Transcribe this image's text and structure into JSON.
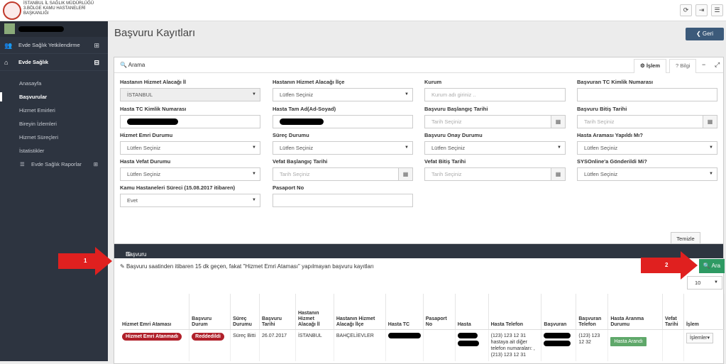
{
  "header": {
    "org_line1": "İSTANBUL İL SAĞLIK MÜDÜRLÜĞÜ",
    "org_line2": "3.BÖLGE KAMU HASTANELERİ",
    "org_line3": "BAŞKANLIĞI",
    "buttons": [
      "refresh-icon",
      "logout-icon",
      "menu-icon"
    ]
  },
  "sidebar": {
    "sections": [
      {
        "label": "Evde Sağlık Yetkilendirme",
        "toggle": "⊞"
      },
      {
        "label": "Evde Sağlık",
        "toggle": "⊟"
      }
    ],
    "items": [
      "Anasayfa",
      "Başvurular",
      "Hizmet Emirleri",
      "Bireyin İzlemleri",
      "Hizmet Süreçleri",
      "İstatistikler",
      "Evde Sağlık Raporlar"
    ],
    "reports_toggle": "⊞"
  },
  "page": {
    "title": "Başvuru Kayıtları",
    "back_label": "Geri"
  },
  "search": {
    "title": "Arama",
    "tab_islem": "İşlem",
    "tab_bilgi": "Bilgi",
    "minimize": "−",
    "expand": "⤢",
    "labels": {
      "il": "Hastanın Hizmet Alacağı İl",
      "ilce": "Hastanın Hizmet Alacağı İlçe",
      "kurum": "Kurum",
      "basvuran_tc": "Başvuran TC Kimlik Numarası",
      "hasta_tc": "Hasta TC Kimlik Numarası",
      "hasta_ad": "Hasta Tam Ad(Ad-Soyad)",
      "bas_baslangic": "Başvuru Başlangıç Tarihi",
      "bas_bitis": "Başvuru Bitiş Tarihi",
      "hizmet_emri": "Hizmet Emri Durumu",
      "surec": "Süreç Durumu",
      "onay": "Başvuru Onay Durumu",
      "aranma": "Hasta Araması Yapıldı Mı?",
      "vefat": "Hasta Vefat Durumu",
      "vefat_bas": "Vefat Başlangıç Tarihi",
      "vefat_bit": "Vefat Bitiş Tarihi",
      "sysonline": "SYSOnline'a Gönderildi Mi?",
      "kamu": "Kamu Hastaneleri Süreci",
      "kamu_date": "(15.08.2017 itibaren)",
      "pasaport": "Pasaport No"
    },
    "values": {
      "il": "İSTANBUL",
      "select_default": "Lütfen Seçiniz",
      "kurum_placeholder": "Kurum adı giriniz ..",
      "date_placeholder": "Tarih Seçiniz",
      "kamu": "Evet"
    },
    "clear_label": "Temizle"
  },
  "records": {
    "title": "Başvuru Kayıtları",
    "notice": "Başvuru saatinden itibaren 15 dk geçen, fakat \"Hizmet Emri Ataması\" yapılmayan başvuru kayıtları",
    "search_label": "Ara",
    "page_size": "10",
    "columns": [
      "Hizmet Emri Ataması",
      "Başvuru Durum",
      "Süreç Durumu",
      "Başvuru Tarihi",
      "Hastanın Hizmet Alacağı İl",
      "Hastanın Hizmet Alacağı İlçe",
      "Hasta TC",
      "Pasaport No",
      "Hasta",
      "Hasta Telefon",
      "Başvuran",
      "Başvuran Telefon",
      "Hasta Aranma Durumu",
      "Vefat Tarihi",
      "İşlem"
    ],
    "row": {
      "hizmet_emri": "Hizmet Emri Atanmadı",
      "durum": "Reddedildi",
      "surec": "Süreç Bitti",
      "tarih": "26.07.2017",
      "il": "İSTANBUL",
      "ilce": "BAHÇELİEVLER",
      "hasta_telefon": "(123) 123 12 31 hastaya ait diğer telefon numaraları: , (213) 123 12 31",
      "basvuran_telefon": "(123) 123 12 32",
      "aranma": "Hasta Arandı",
      "islem": "İşlemler"
    }
  },
  "annotations": {
    "arrow1": "1",
    "arrow2": "2"
  },
  "colors": {
    "sidebar": "#2d3440",
    "danger": "#b0202a",
    "success": "#2e9a63",
    "back": "#3c5a7a",
    "arrow": "#e0201f"
  }
}
